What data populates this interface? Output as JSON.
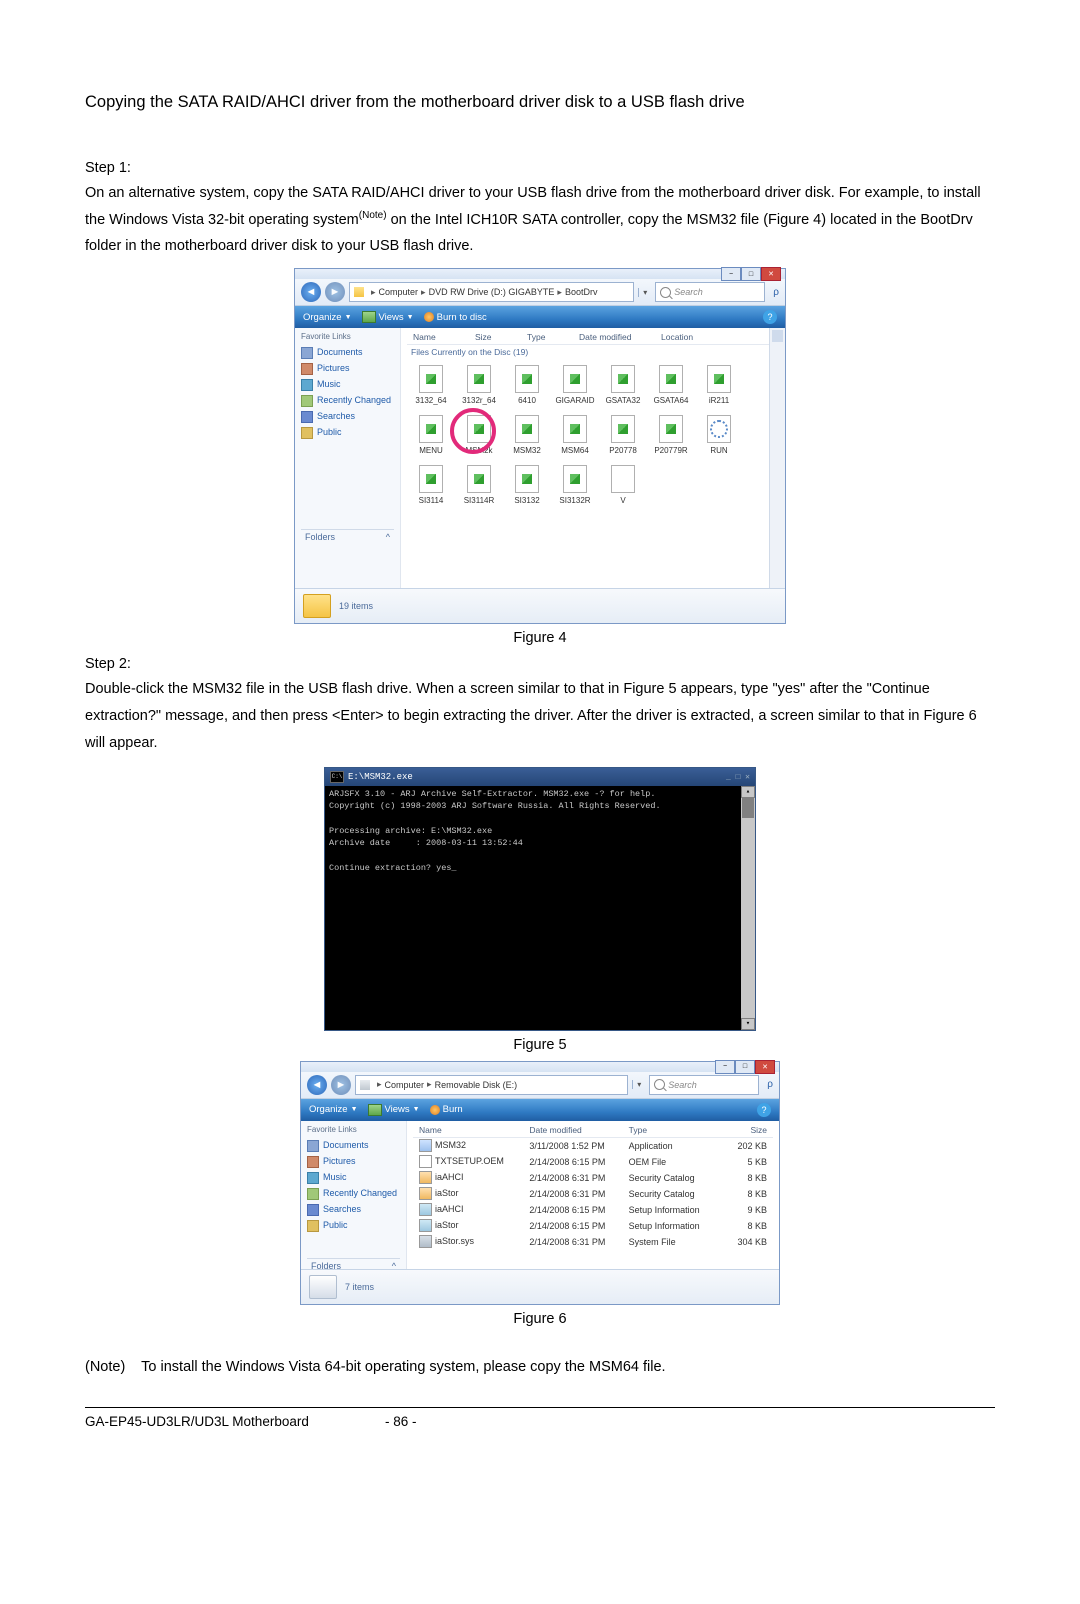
{
  "title": "Copying the SATA RAID/AHCI driver from the motherboard driver disk to a USB flash drive",
  "steps": {
    "s1_label": "Step 1:",
    "s1_text_a": "On an alternative system, copy the SATA RAID/AHCI driver to your USB flash drive from the motherboard driver disk. For example, to install the Windows Vista 32-bit operating system",
    "s1_note_sup": "(Note)",
    "s1_text_b": " on the Intel ICH10R SATA controller, copy the ",
    "s1_bold1": "MSM32",
    "s1_text_c": " file (Figure 4) located in the ",
    "s1_bold2": "BootDrv",
    "s1_text_d": " folder in the motherboard driver disk to your USB flash drive.",
    "s2_label": "Step 2:",
    "s2_text_a": "Double-click the ",
    "s2_bold1": "MSM32",
    "s2_text_b": " file in the USB flash drive. When a screen similar to that in Figure 5 appears, type \"yes\" after the \"Continue extraction?\" message, and then press <Enter> to begin extracting the driver. After the driver is extracted, a screen similar to that in Figure 6 will appear."
  },
  "figure4": {
    "caption": "Figure 4",
    "breadcrumb": [
      "Computer",
      "DVD RW Drive (D:) GIGABYTE",
      "BootDrv"
    ],
    "search_placeholder": "Search",
    "toolbar": {
      "organize": "Organize",
      "views": "Views",
      "burn": "Burn to disc"
    },
    "favorites_label": "Favorite Links",
    "sidebar": [
      "Documents",
      "Pictures",
      "Music",
      "Recently Changed",
      "Searches",
      "Public"
    ],
    "folders_label": "Folders",
    "columns": [
      "Name",
      "Size",
      "Type",
      "Date modified",
      "Location"
    ],
    "group": "Files Currently on the Disc (19)",
    "icons": [
      "3132_64",
      "3132r_64",
      "6410",
      "GIGARAID",
      "GSATA32",
      "GSATA64",
      "iR211",
      "MENU",
      "MSM2k",
      "MSM32",
      "MSM64",
      "P20778",
      "P20779R",
      "RUN",
      "SI3114",
      "SI3114R",
      "SI3132",
      "SI3132R",
      "V"
    ],
    "status": "19 items"
  },
  "figure5": {
    "caption": "Figure 5",
    "title": "E:\\MSM32.exe",
    "lines": [
      "ARJSFX 3.10 - ARJ Archive Self-Extractor. MSM32.exe -? for help.",
      "Copyright (c) 1998-2003 ARJ Software Russia. All Rights Reserved.",
      "",
      "Processing archive: E:\\MSM32.exe",
      "Archive date     : 2008-03-11 13:52:44",
      "",
      "Continue extraction? yes_"
    ]
  },
  "figure6": {
    "caption": "Figure 6",
    "breadcrumb": [
      "Computer",
      "Removable Disk (E:)"
    ],
    "search_placeholder": "Search",
    "toolbar": {
      "organize": "Organize",
      "views": "Views",
      "burn": "Burn"
    },
    "favorites_label": "Favorite Links",
    "sidebar": [
      "Documents",
      "Pictures",
      "Music",
      "Recently Changed",
      "Searches",
      "Public"
    ],
    "folders_label": "Folders",
    "columns": [
      "Name",
      "Date modified",
      "Type",
      "Size"
    ],
    "rows": [
      {
        "ico": "app",
        "name": "MSM32",
        "date": "3/11/2008 1:52 PM",
        "type": "Application",
        "size": "202 KB"
      },
      {
        "ico": "txt",
        "name": "TXTSETUP.OEM",
        "date": "2/14/2008 6:15 PM",
        "type": "OEM File",
        "size": "5 KB"
      },
      {
        "ico": "cat",
        "name": "iaAHCI",
        "date": "2/14/2008 6:31 PM",
        "type": "Security Catalog",
        "size": "8 KB"
      },
      {
        "ico": "cat",
        "name": "iaStor",
        "date": "2/14/2008 6:31 PM",
        "type": "Security Catalog",
        "size": "8 KB"
      },
      {
        "ico": "inf",
        "name": "iaAHCI",
        "date": "2/14/2008 6:15 PM",
        "type": "Setup Information",
        "size": "9 KB"
      },
      {
        "ico": "inf",
        "name": "iaStor",
        "date": "2/14/2008 6:15 PM",
        "type": "Setup Information",
        "size": "8 KB"
      },
      {
        "ico": "sys",
        "name": "iaStor.sys",
        "date": "2/14/2008 6:31 PM",
        "type": "System File",
        "size": "304 KB"
      }
    ],
    "status": "7 items"
  },
  "note": {
    "label": "(Note)",
    "text_a": "To install the Windows Vista 64-bit operating system, please copy the ",
    "bold": "MSM64",
    "text_b": " file."
  },
  "footer": {
    "model": "GA-EP45-UD3LR/UD3L Motherboard",
    "page": "- 86 -"
  }
}
